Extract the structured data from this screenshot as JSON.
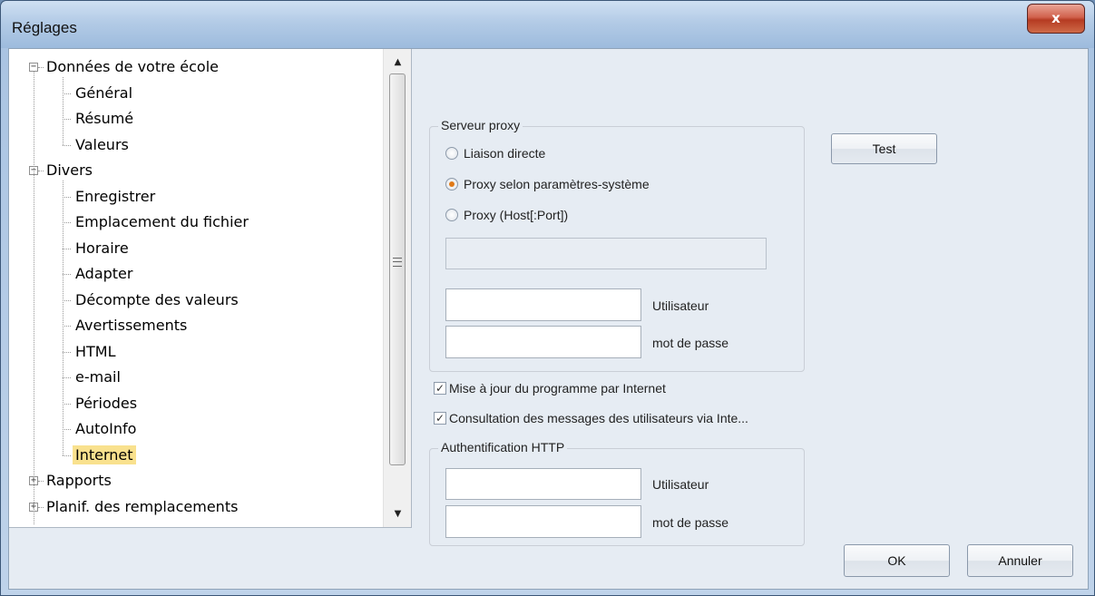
{
  "window": {
    "title": "Réglages",
    "close_glyph": "x"
  },
  "tree": {
    "nodes": [
      {
        "label": "Données de votre école",
        "expander": "−"
      },
      {
        "label": "Général"
      },
      {
        "label": "Résumé"
      },
      {
        "label": "Valeurs"
      },
      {
        "label": "Divers",
        "expander": "−"
      },
      {
        "label": "Enregistrer"
      },
      {
        "label": "Emplacement du fichier"
      },
      {
        "label": "Horaire"
      },
      {
        "label": "Adapter"
      },
      {
        "label": "Décompte des valeurs"
      },
      {
        "label": "Avertissements"
      },
      {
        "label": "HTML"
      },
      {
        "label": "e-mail"
      },
      {
        "label": "Périodes"
      },
      {
        "label": "AutoInfo"
      },
      {
        "label": "Internet",
        "selected": true
      },
      {
        "label": "Rapports",
        "expander": "+"
      },
      {
        "label": "Planif. des remplacements",
        "expander": "+"
      }
    ]
  },
  "proxy": {
    "title": "Serveur proxy",
    "options": [
      "Liaison directe",
      "Proxy selon paramètres-système",
      "Proxy (Host[:Port])"
    ],
    "selected_index": 1,
    "host_value": "",
    "user_value": "",
    "user_label": "Utilisateur",
    "password_value": "",
    "password_label": "mot de passe"
  },
  "checks": [
    {
      "label": "Mise à jour du programme par Internet",
      "checked": true
    },
    {
      "label": "Consultation des messages des utilisateurs via Inte...",
      "checked": true
    }
  ],
  "http_auth": {
    "title": "Authentification HTTP",
    "user_value": "",
    "user_label": "Utilisateur",
    "password_value": "",
    "password_label": "mot de passe"
  },
  "buttons": {
    "test": "Test",
    "ok": "OK",
    "cancel": "Annuler"
  },
  "scrollbar": {
    "up_glyph": "▲",
    "down_glyph": "▼"
  },
  "colors": {
    "selection": "#f9e18e",
    "radio_accent": "#e07a18",
    "close_button": "#c14a30"
  }
}
